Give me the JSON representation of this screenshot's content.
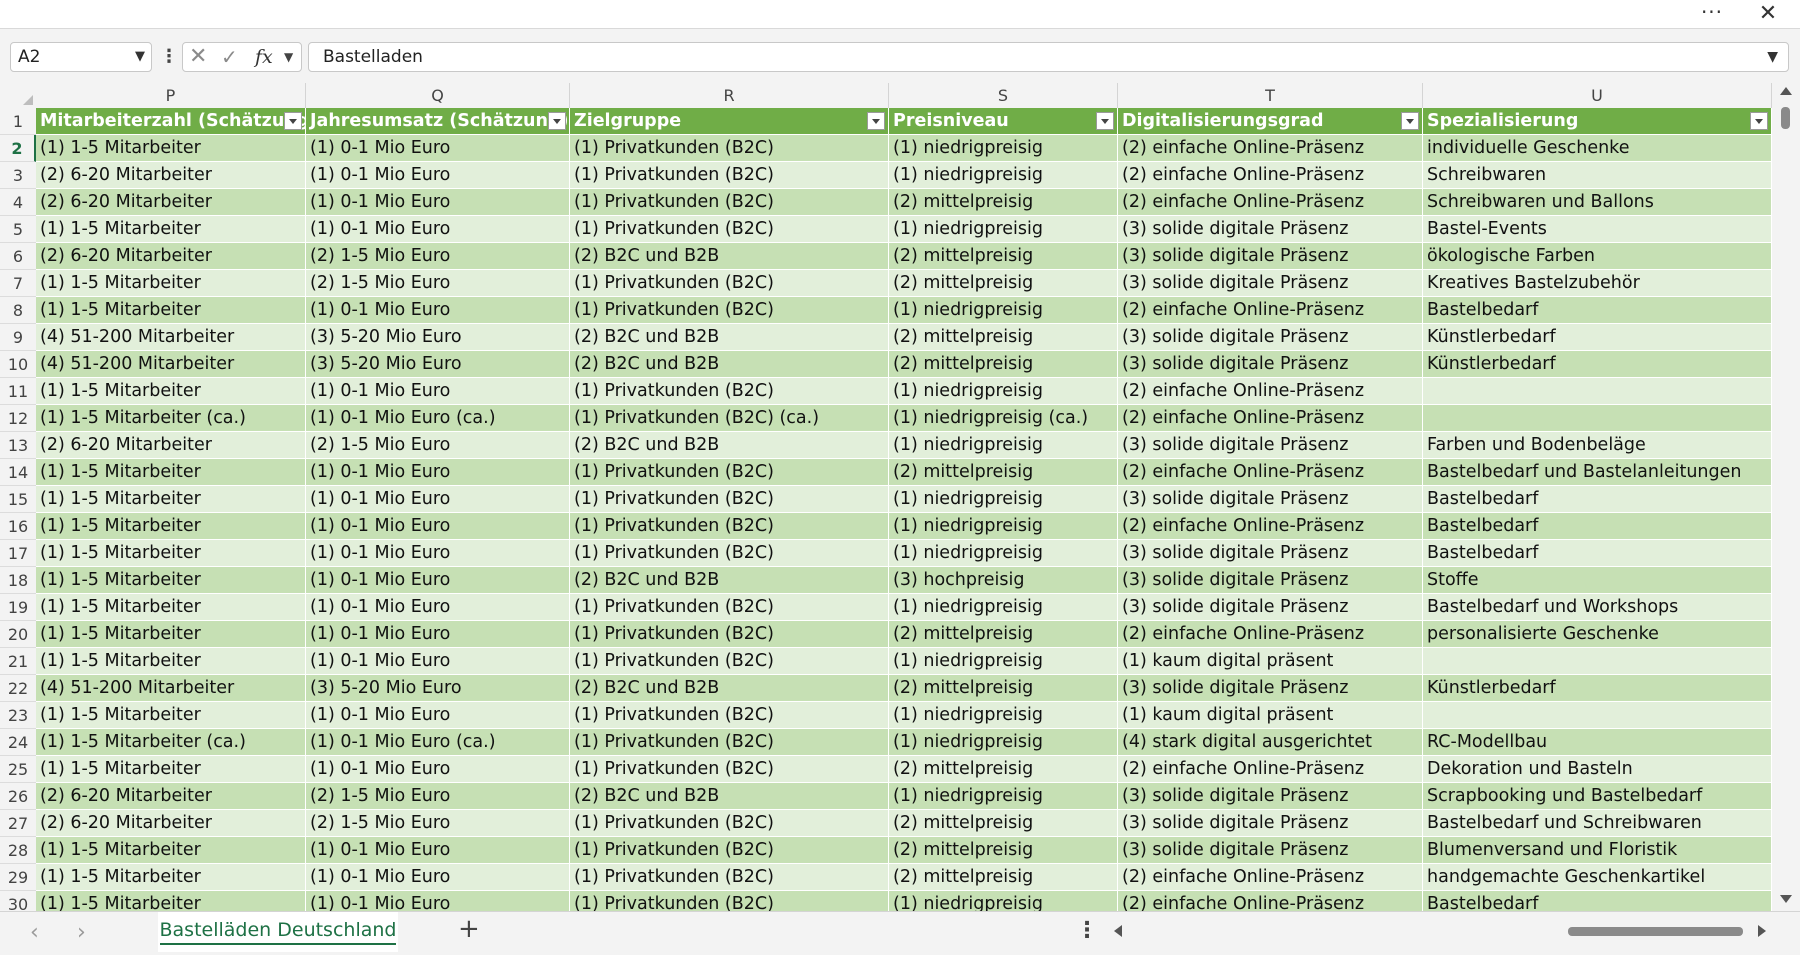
{
  "toolbar": {
    "more": "···",
    "close": "✕"
  },
  "formula_bar": {
    "name_box": "A2",
    "cancel": "✕",
    "enter": "✓",
    "fx": "fx",
    "formula": "Bastelladen"
  },
  "columns": [
    "P",
    "Q",
    "R",
    "S",
    "T",
    "U"
  ],
  "header_row_number": "1",
  "headers": [
    "Mitarbeiterzahl (Schätzung)",
    "Jahresumsatz (Schätzung)",
    "Zielgruppe",
    "Preisniveau",
    "Digitalisierungsgrad",
    "Spezialisierung"
  ],
  "rows": [
    {
      "num": "2",
      "cells": [
        "(1) 1-5 Mitarbeiter",
        "(1) 0-1 Mio Euro",
        "(1) Privatkunden (B2C)",
        "(1) niedrigpreisig",
        "(2) einfache Online-Präsenz",
        "individuelle Geschenke"
      ]
    },
    {
      "num": "3",
      "cells": [
        "(2) 6-20 Mitarbeiter",
        "(1) 0-1 Mio Euro",
        "(1) Privatkunden (B2C)",
        "(1) niedrigpreisig",
        "(2) einfache Online-Präsenz",
        "Schreibwaren"
      ]
    },
    {
      "num": "4",
      "cells": [
        "(2) 6-20 Mitarbeiter",
        "(1) 0-1 Mio Euro",
        "(1) Privatkunden (B2C)",
        "(2) mittelpreisig",
        "(2) einfache Online-Präsenz",
        "Schreibwaren und Ballons"
      ]
    },
    {
      "num": "5",
      "cells": [
        "(1) 1-5 Mitarbeiter",
        "(1) 0-1 Mio Euro",
        "(1) Privatkunden (B2C)",
        "(1) niedrigpreisig",
        "(3) solide digitale Präsenz",
        "Bastel-Events"
      ]
    },
    {
      "num": "6",
      "cells": [
        "(2) 6-20 Mitarbeiter",
        "(2) 1-5 Mio Euro",
        "(2) B2C und B2B",
        "(2) mittelpreisig",
        "(3) solide digitale Präsenz",
        "ökologische Farben"
      ]
    },
    {
      "num": "7",
      "cells": [
        "(1) 1-5 Mitarbeiter",
        "(2) 1-5 Mio Euro",
        "(1) Privatkunden (B2C)",
        "(2) mittelpreisig",
        "(3) solide digitale Präsenz",
        "Kreatives Bastelzubehör"
      ]
    },
    {
      "num": "8",
      "cells": [
        "(1) 1-5 Mitarbeiter",
        "(1) 0-1 Mio Euro",
        "(1) Privatkunden (B2C)",
        "(1) niedrigpreisig",
        "(2) einfache Online-Präsenz",
        "Bastelbedarf"
      ]
    },
    {
      "num": "9",
      "cells": [
        "(4) 51-200 Mitarbeiter",
        "(3) 5-20 Mio Euro",
        "(2) B2C und B2B",
        "(2) mittelpreisig",
        "(3) solide digitale Präsenz",
        "Künstlerbedarf"
      ]
    },
    {
      "num": "10",
      "cells": [
        "(4) 51-200 Mitarbeiter",
        "(3) 5-20 Mio Euro",
        "(2) B2C und B2B",
        "(2) mittelpreisig",
        "(3) solide digitale Präsenz",
        "Künstlerbedarf"
      ]
    },
    {
      "num": "11",
      "cells": [
        "(1) 1-5 Mitarbeiter",
        "(1) 0-1 Mio Euro",
        "(1) Privatkunden (B2C)",
        "(1) niedrigpreisig",
        "(2) einfache Online-Präsenz",
        ""
      ]
    },
    {
      "num": "12",
      "cells": [
        "(1) 1-5 Mitarbeiter (ca.)",
        "(1) 0-1 Mio Euro (ca.)",
        "(1) Privatkunden (B2C) (ca.)",
        "(1) niedrigpreisig (ca.)",
        "(2) einfache Online-Präsenz",
        ""
      ]
    },
    {
      "num": "13",
      "cells": [
        "(2) 6-20 Mitarbeiter",
        "(2) 1-5 Mio Euro",
        "(2) B2C und B2B",
        "(1) niedrigpreisig",
        "(3) solide digitale Präsenz",
        "Farben und Bodenbeläge"
      ]
    },
    {
      "num": "14",
      "cells": [
        "(1) 1-5 Mitarbeiter",
        "(1) 0-1 Mio Euro",
        "(1) Privatkunden (B2C)",
        "(2) mittelpreisig",
        "(2) einfache Online-Präsenz",
        "Bastelbedarf und Bastelanleitungen"
      ]
    },
    {
      "num": "15",
      "cells": [
        "(1) 1-5 Mitarbeiter",
        "(1) 0-1 Mio Euro",
        "(1) Privatkunden (B2C)",
        "(1) niedrigpreisig",
        "(3) solide digitale Präsenz",
        "Bastelbedarf"
      ]
    },
    {
      "num": "16",
      "cells": [
        "(1) 1-5 Mitarbeiter",
        "(1) 0-1 Mio Euro",
        "(1) Privatkunden (B2C)",
        "(1) niedrigpreisig",
        "(2) einfache Online-Präsenz",
        "Bastelbedarf"
      ]
    },
    {
      "num": "17",
      "cells": [
        "(1) 1-5 Mitarbeiter",
        "(1) 0-1 Mio Euro",
        "(1) Privatkunden (B2C)",
        "(1) niedrigpreisig",
        "(3) solide digitale Präsenz",
        "Bastelbedarf"
      ]
    },
    {
      "num": "18",
      "cells": [
        "(1) 1-5 Mitarbeiter",
        "(1) 0-1 Mio Euro",
        "(2) B2C und B2B",
        "(3) hochpreisig",
        "(3) solide digitale Präsenz",
        "Stoffe"
      ]
    },
    {
      "num": "19",
      "cells": [
        "(1) 1-5 Mitarbeiter",
        "(1) 0-1 Mio Euro",
        "(1) Privatkunden (B2C)",
        "(1) niedrigpreisig",
        "(3) solide digitale Präsenz",
        "Bastelbedarf und Workshops"
      ]
    },
    {
      "num": "20",
      "cells": [
        "(1) 1-5 Mitarbeiter",
        "(1) 0-1 Mio Euro",
        "(1) Privatkunden (B2C)",
        "(2) mittelpreisig",
        "(2) einfache Online-Präsenz",
        "personalisierte Geschenke"
      ]
    },
    {
      "num": "21",
      "cells": [
        "(1) 1-5 Mitarbeiter",
        "(1) 0-1 Mio Euro",
        "(1) Privatkunden (B2C)",
        "(1) niedrigpreisig",
        "(1) kaum digital präsent",
        ""
      ]
    },
    {
      "num": "22",
      "cells": [
        "(4) 51-200 Mitarbeiter",
        "(3) 5-20 Mio Euro",
        "(2) B2C und B2B",
        "(2) mittelpreisig",
        "(3) solide digitale Präsenz",
        "Künstlerbedarf"
      ]
    },
    {
      "num": "23",
      "cells": [
        "(1) 1-5 Mitarbeiter",
        "(1) 0-1 Mio Euro",
        "(1) Privatkunden (B2C)",
        "(1) niedrigpreisig",
        "(1) kaum digital präsent",
        ""
      ]
    },
    {
      "num": "24",
      "cells": [
        "(1) 1-5 Mitarbeiter (ca.)",
        "(1) 0-1 Mio Euro (ca.)",
        "(1) Privatkunden (B2C)",
        "(1) niedrigpreisig",
        "(4) stark digital ausgerichtet",
        "RC-Modellbau"
      ]
    },
    {
      "num": "25",
      "cells": [
        "(1) 1-5 Mitarbeiter",
        "(1) 0-1 Mio Euro",
        "(1) Privatkunden (B2C)",
        "(2) mittelpreisig",
        "(2) einfache Online-Präsenz",
        "Dekoration und Basteln"
      ]
    },
    {
      "num": "26",
      "cells": [
        "(2) 6-20 Mitarbeiter",
        "(2) 1-5 Mio Euro",
        "(2) B2C und B2B",
        "(1) niedrigpreisig",
        "(3) solide digitale Präsenz",
        "Scrapbooking und Bastelbedarf"
      ]
    },
    {
      "num": "27",
      "cells": [
        "(2) 6-20 Mitarbeiter",
        "(2) 1-5 Mio Euro",
        "(1) Privatkunden (B2C)",
        "(2) mittelpreisig",
        "(3) solide digitale Präsenz",
        "Bastelbedarf und Schreibwaren"
      ]
    },
    {
      "num": "28",
      "cells": [
        "(1) 1-5 Mitarbeiter",
        "(1) 0-1 Mio Euro",
        "(1) Privatkunden (B2C)",
        "(2) mittelpreisig",
        "(3) solide digitale Präsenz",
        "Blumenversand und Floristik"
      ]
    },
    {
      "num": "29",
      "cells": [
        "(1) 1-5 Mitarbeiter",
        "(1) 0-1 Mio Euro",
        "(1) Privatkunden (B2C)",
        "(2) mittelpreisig",
        "(2) einfache Online-Präsenz",
        "handgemachte Geschenkartikel"
      ]
    },
    {
      "num": "30",
      "cells": [
        "(1) 1-5 Mitarbeiter",
        "(1) 0-1 Mio Euro",
        "(1) Privatkunden (B2C)",
        "(1) niedrigpreisig",
        "(2) einfache Online-Präsenz",
        "Bastelbedarf"
      ]
    }
  ],
  "sheet_tabs": {
    "prev": "‹",
    "next": "›",
    "active": "Bastelläden Deutschland",
    "add": "+",
    "more": "⋮"
  },
  "colors": {
    "header_green": "#70ad47",
    "band_dark": "#c6e0b4",
    "band_light": "#e2efda",
    "accent": "#1e7145"
  }
}
